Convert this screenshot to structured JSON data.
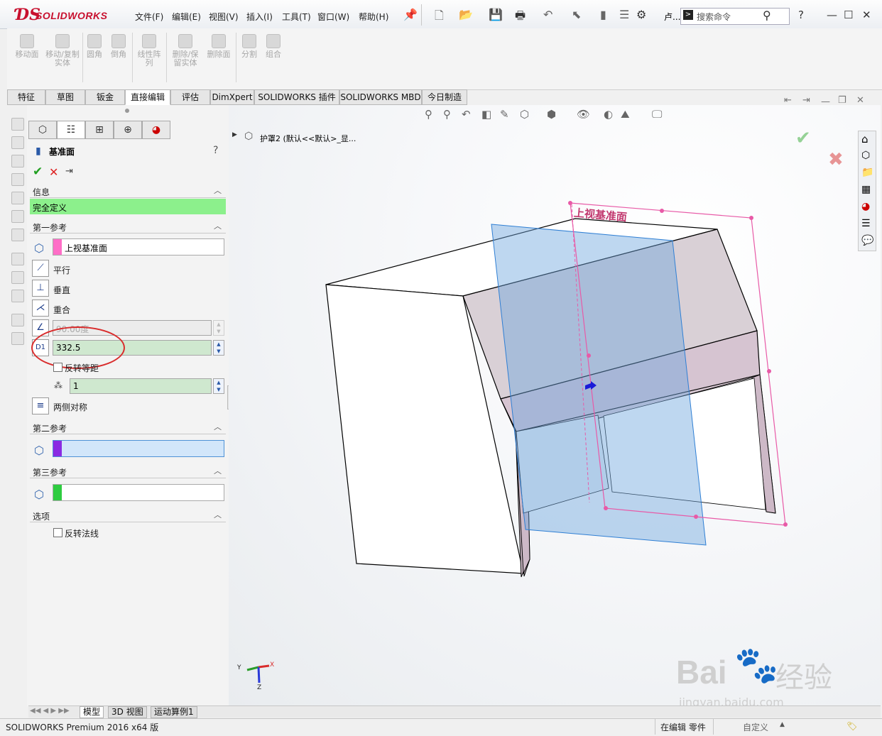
{
  "app": {
    "logo_text": "SOLIDWORKS",
    "menus": [
      "文件(F)",
      "编辑(E)",
      "视图(V)",
      "插入(I)",
      "工具(T)",
      "窗口(W)",
      "帮助(H)"
    ],
    "search_placeholder": "搜索命令",
    "truncated_label": "卢..."
  },
  "ribbon": {
    "buttons": [
      "移动面",
      "移动/复制实体",
      "圆角",
      "倒角",
      "线性阵列",
      "删除/保留实体",
      "删除面",
      "分割",
      "组合"
    ]
  },
  "tabs": {
    "items": [
      "特征",
      "草图",
      "钣金",
      "直接编辑",
      "评估",
      "DimXpert",
      "SOLIDWORKS 插件",
      "SOLIDWORKS MBD",
      "今日制造"
    ],
    "active": "直接编辑"
  },
  "pm": {
    "title": "基准面",
    "help": "?",
    "info_header": "信息",
    "status": "完全定义",
    "first_ref_header": "第一参考",
    "first_ref_value": "上视基准面",
    "opt_parallel": "平行",
    "opt_perpendicular": "垂直",
    "opt_coincident": "重合",
    "angle_value": "90.00度",
    "distance_value": "332.5",
    "flip_offset": "反转等距",
    "instances": "1",
    "mid_plane": "两侧对称",
    "second_ref_header": "第二参考",
    "third_ref_header": "第三参考",
    "options_header": "选项",
    "flip_normal": "反转法线",
    "colors": {
      "status_green": "#8cf08c",
      "first_ref_pink": "#ff6ec7",
      "second_ref_purple": "#8a2be2",
      "third_ref_green": "#2ecc40"
    }
  },
  "tree": {
    "part_label": "护罩2 (默认<<默认>_显..."
  },
  "viewport": {
    "plane_label": "上视基准面",
    "axis_x": "X",
    "axis_y": "Y",
    "axis_z": "Z"
  },
  "bottom_tabs": {
    "items": [
      "模型",
      "3D 视图",
      "运动算例1"
    ],
    "active": "模型"
  },
  "status": {
    "version": "SOLIDWORKS Premium 2016 x64 版",
    "editing": "在编辑 零件",
    "units": "自定义"
  },
  "watermark": {
    "brand": "Bai",
    "brand2": "经验",
    "url": "jingyan.baidu.com"
  }
}
